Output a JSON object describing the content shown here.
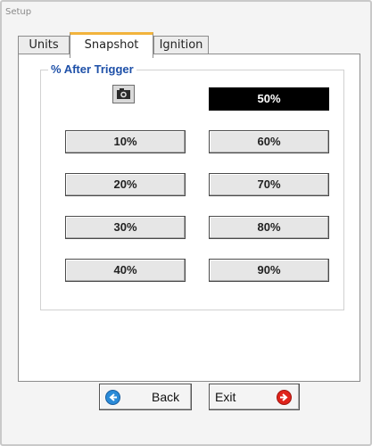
{
  "window": {
    "title": "Setup"
  },
  "tabs": [
    {
      "label": "Units"
    },
    {
      "label": "Snapshot"
    },
    {
      "label": "Ignition"
    }
  ],
  "active_tab": "Snapshot",
  "snapshot": {
    "group_title": "% After Trigger",
    "camera_icon": "camera-icon",
    "selected_value": "50%",
    "buttons": {
      "p50": "50%",
      "p10": "10%",
      "p20": "20%",
      "p30": "30%",
      "p40": "40%",
      "p60": "60%",
      "p70": "70%",
      "p80": "80%",
      "p90": "90%"
    }
  },
  "nav": {
    "back_label": "Back",
    "back_icon": "arrow-left-icon",
    "exit_label": "Exit",
    "exit_icon": "arrow-right-icon"
  },
  "colors": {
    "tab_accent": "#f2b33c",
    "group_title": "#1e50a8",
    "selected_bg": "#000000",
    "back_icon": "#2a8bd8",
    "exit_icon": "#e0231b"
  }
}
